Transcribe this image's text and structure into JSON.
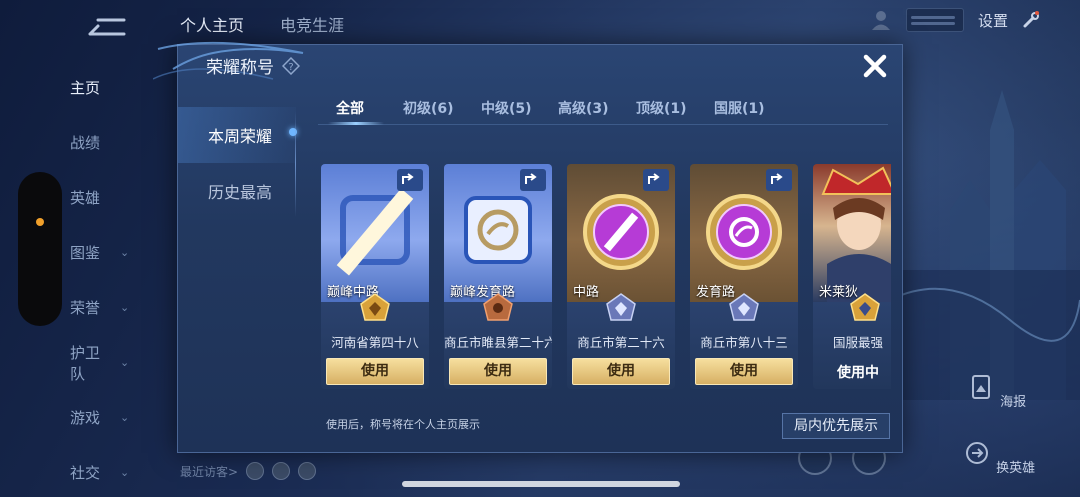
{
  "background": {
    "top_tabs": [
      "个人主页",
      "电竞生涯"
    ],
    "settings_label": "设置",
    "nav_items": [
      {
        "label": "主页",
        "chevron": false
      },
      {
        "label": "战绩",
        "chevron": false
      },
      {
        "label": "英雄",
        "chevron": false
      },
      {
        "label": "图鉴",
        "chevron": true
      },
      {
        "label": "荣誉",
        "chevron": true
      },
      {
        "label": "护卫队",
        "chevron": true
      },
      {
        "label": "游戏",
        "chevron": true
      },
      {
        "label": "社交",
        "chevron": true
      }
    ],
    "recent_visitors": "最近访客>",
    "poster_label": "海报",
    "change_hero_label": "换英雄"
  },
  "modal": {
    "title": "荣耀称号",
    "side_tabs": [
      "本周荣耀",
      "历史最高"
    ],
    "filter_tabs": [
      "全部",
      "初级(6)",
      "中级(5)",
      "高级(3)",
      "顶级(1)",
      "国服(1)"
    ],
    "cards": [
      {
        "name": "巅峰中路",
        "region": "河南省第四十八",
        "action": "使用",
        "style": "blue",
        "emblem": "gold"
      },
      {
        "name": "巅峰发育路",
        "region": "商丘市睢县第二十六",
        "action": "使用",
        "style": "blue",
        "emblem": "bronze"
      },
      {
        "name": "中路",
        "region": "商丘市第二十六",
        "action": "使用",
        "style": "gold",
        "emblem": "silver"
      },
      {
        "name": "发育路",
        "region": "商丘市第八十三",
        "action": "使用",
        "style": "gold",
        "emblem": "silver"
      },
      {
        "name": "米莱狄",
        "region": "国服最强",
        "action": "使用中",
        "style": "portrait",
        "emblem": "gold"
      }
    ],
    "footnote": "使用后，称号将在个人主页展示",
    "priority_button": "局内优先展示"
  },
  "colors": {
    "accent_gold": "#d7b064",
    "active_dot": "#f0a02b",
    "modal_bg": "#22385f"
  }
}
